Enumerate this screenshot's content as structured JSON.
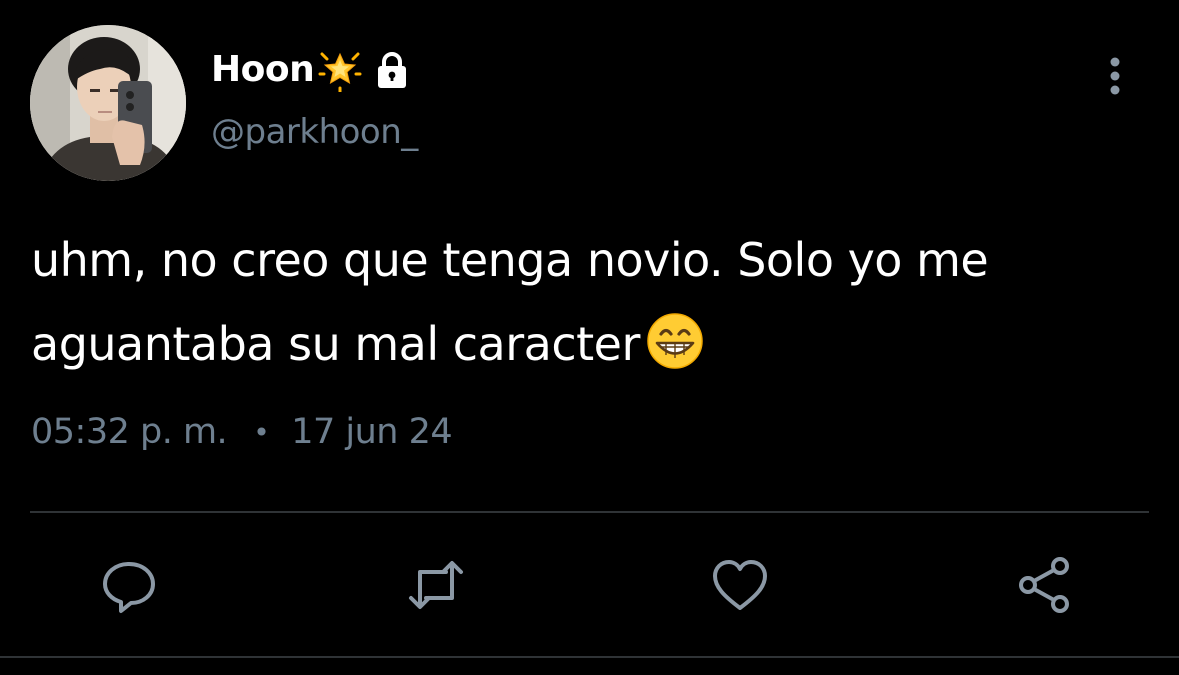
{
  "tweet": {
    "display_name": "Hoon",
    "handle": "@parkhoon_",
    "text_line1": "uhm, no creo que tenga novio. Solo yo me",
    "text_line2": "aguantaba su mal caracter",
    "emoji": "grinning-face-with-smiling-eyes",
    "time": "05:32 p. m.",
    "separator": "•",
    "date": "17 jun 24"
  },
  "icons": {
    "badge": "glowing-star-icon",
    "protected": "lock-icon",
    "overflow": "more-vertical-icon",
    "actions": [
      "reply-icon",
      "retweet-icon",
      "like-icon",
      "share-icon"
    ]
  },
  "colors": {
    "background": "#000000",
    "text": "#ffffff",
    "secondary": "#6e7f8f",
    "icon": "#8b98a5",
    "divider": "#2f3336"
  }
}
